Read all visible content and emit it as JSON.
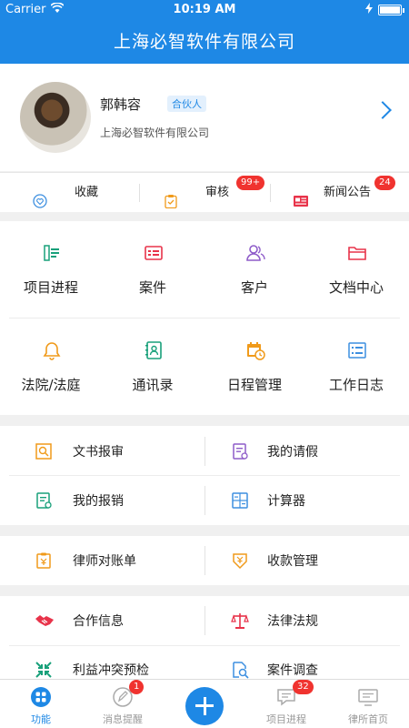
{
  "status": {
    "carrier": "Carrier",
    "time": "10:19 AM"
  },
  "header": {
    "title": "上海必智软件有限公司"
  },
  "profile": {
    "name": "郭韩容",
    "role": "合伙人",
    "company": "上海必智软件有限公司"
  },
  "quick": [
    {
      "label": "收藏",
      "icon": "heart-icon"
    },
    {
      "label": "审核",
      "icon": "clipboard-check-icon",
      "badge": "99+"
    },
    {
      "label": "新闻公告",
      "icon": "newspaper-icon",
      "badge": "24"
    }
  ],
  "grid": [
    {
      "label": "项目进程",
      "icon": "project-progress-icon"
    },
    {
      "label": "案件",
      "icon": "case-folder-icon"
    },
    {
      "label": "客户",
      "icon": "client-people-icon"
    },
    {
      "label": "文档中心",
      "icon": "document-folder-icon"
    },
    {
      "label": "法院/法庭",
      "icon": "court-bell-icon"
    },
    {
      "label": "通讯录",
      "icon": "contacts-book-icon"
    },
    {
      "label": "日程管理",
      "icon": "calendar-clock-icon"
    },
    {
      "label": "工作日志",
      "icon": "worklog-list-icon"
    }
  ],
  "list1": [
    {
      "label": "文书报审",
      "icon": "document-review-icon"
    },
    {
      "label": "我的请假",
      "icon": "leave-form-icon"
    },
    {
      "label": "我的报销",
      "icon": "reimbursement-icon"
    },
    {
      "label": "计算器",
      "icon": "calculator-icon"
    }
  ],
  "list2": [
    {
      "label": "律师对账单",
      "icon": "statement-icon"
    },
    {
      "label": "收款管理",
      "icon": "payment-icon"
    }
  ],
  "list3": [
    {
      "label": "合作信息",
      "icon": "handshake-icon"
    },
    {
      "label": "法律法规",
      "icon": "scales-icon"
    },
    {
      "label": "利益冲突预检",
      "icon": "conflict-check-icon"
    },
    {
      "label": "案件调查",
      "icon": "case-search-icon"
    }
  ],
  "tabs": [
    {
      "label": "功能",
      "icon": "grid-apps-icon",
      "active": true
    },
    {
      "label": "消息提醒",
      "icon": "message-pen-icon",
      "badge": "1"
    },
    {
      "label": "",
      "icon": "plus-icon"
    },
    {
      "label": "项目进程",
      "icon": "chat-bubble-icon",
      "badge": "32"
    },
    {
      "label": "律所首页",
      "icon": "monitor-icon"
    }
  ],
  "colors": {
    "primary": "#1e88e5",
    "orange": "#f09a1a",
    "red": "#e8334a",
    "purple": "#8e5cc9",
    "green": "#18a07a",
    "blue": "#3d8fe0",
    "badge": "#f0332f"
  }
}
